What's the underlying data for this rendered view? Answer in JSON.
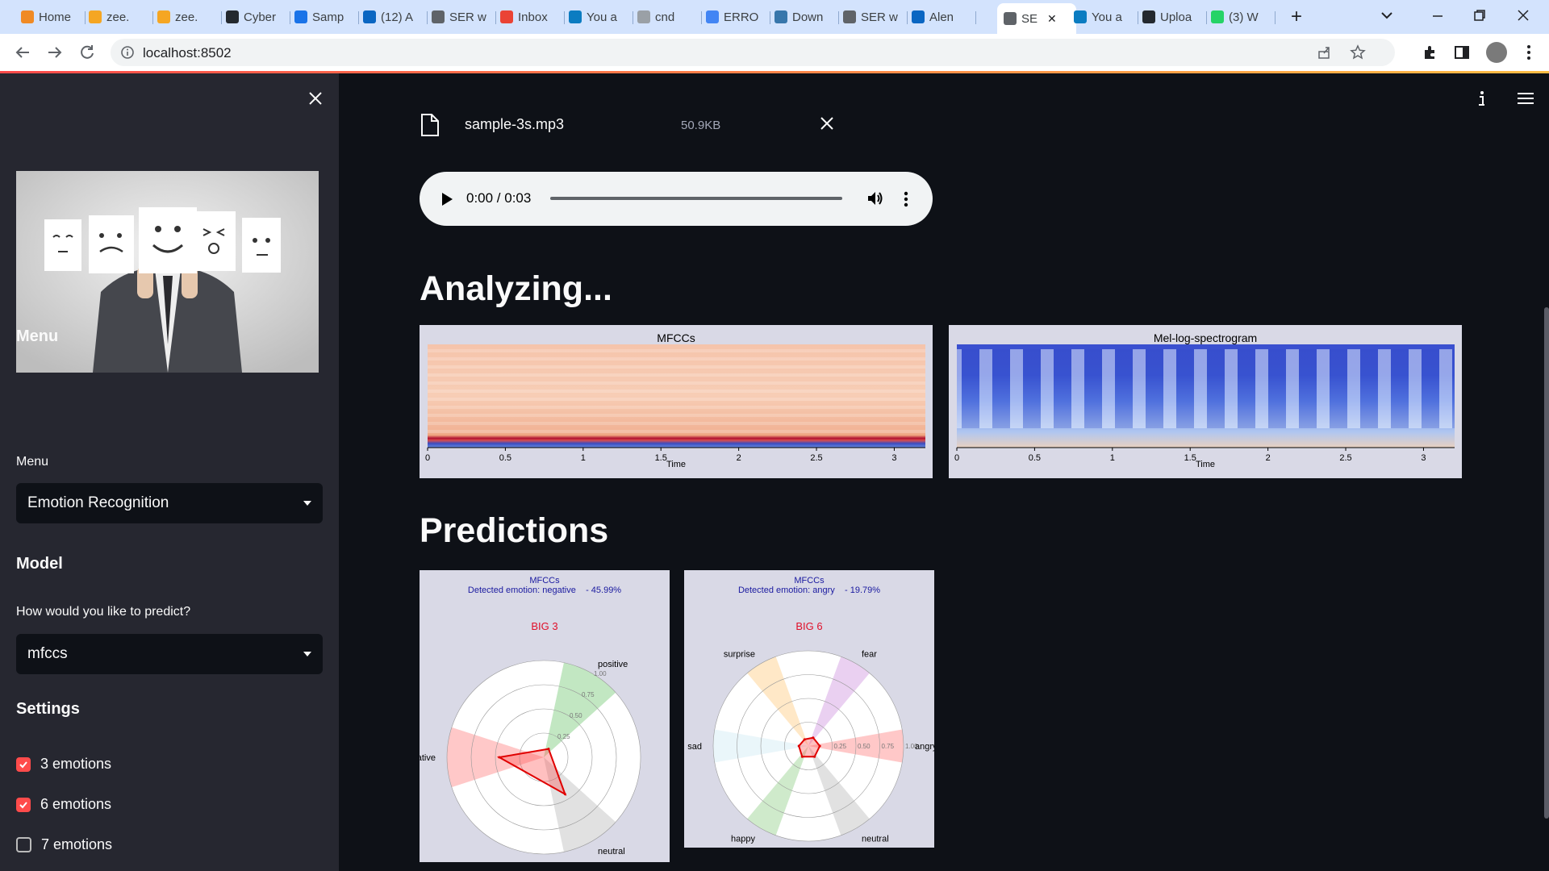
{
  "browser": {
    "tabs": [
      {
        "label": "Home",
        "color": "#f08a24"
      },
      {
        "label": "zee.",
        "color": "#f5a623"
      },
      {
        "label": "zee.",
        "color": "#f5a623"
      },
      {
        "label": "Cyber",
        "color": "#24292f"
      },
      {
        "label": "Samp",
        "color": "#1a73e8"
      },
      {
        "label": "(12) A",
        "color": "#0a66c2"
      },
      {
        "label": "SER w",
        "color": "#5f6368"
      },
      {
        "label": "Inbox",
        "color": "#ea4335"
      },
      {
        "label": "You a",
        "color": "#0b7cc1"
      },
      {
        "label": "cnd",
        "color": "#9aa0a6"
      },
      {
        "label": "ERRO",
        "color": "#4285f4"
      },
      {
        "label": "Down",
        "color": "#3776ab"
      },
      {
        "label": "SER w",
        "color": "#5f6368"
      },
      {
        "label": "Alen",
        "color": "#0a66c2"
      },
      {
        "label": "SE",
        "color": "#5f6368"
      },
      {
        "label": "You a",
        "color": "#0b7cc1"
      },
      {
        "label": "Uploa",
        "color": "#24292f"
      },
      {
        "label": "(3) W",
        "color": "#25d366"
      }
    ],
    "url": "localhost:8502"
  },
  "sidebar": {
    "menu_title": "Menu",
    "menu_label": "Menu",
    "menu_value": "Emotion Recognition",
    "model_title": "Model",
    "predict_label": "How would you like to predict?",
    "predict_value": "mfccs",
    "settings_title": "Settings",
    "checkboxes": [
      {
        "label": "3 emotions",
        "checked": true
      },
      {
        "label": "6 emotions",
        "checked": true
      },
      {
        "label": "7 emotions",
        "checked": false
      }
    ]
  },
  "file": {
    "name": "sample-3s.mp3",
    "size": "50.9KB"
  },
  "audio": {
    "time": "0:00 / 0:03",
    "progress": 0.0
  },
  "analyzing_title": "Analyzing...",
  "predictions_title": "Predictions",
  "spectrograms": [
    {
      "title": "MFCCs",
      "xlabel": "Time",
      "ticks": [
        "0",
        "0.5",
        "1",
        "1.5",
        "2",
        "2.5",
        "3"
      ]
    },
    {
      "title": "Mel-log-spectrogram",
      "xlabel": "Time",
      "ticks": [
        "0",
        "0.5",
        "1",
        "1.5",
        "2",
        "2.5",
        "3"
      ]
    }
  ],
  "chart_data": [
    {
      "type": "radar",
      "title": "MFCCs",
      "subtitle": "Detected emotion: negative",
      "score_text": "- 45.99%",
      "chart_label": "BIG 3",
      "categories": [
        "positive",
        "negative",
        "neutral"
      ],
      "values": [
        0.1,
        0.46,
        0.44
      ],
      "radial_ticks": [
        "0.25",
        "0.50",
        "0.75",
        "1.00"
      ],
      "ylim": [
        0,
        1
      ],
      "colors": [
        "#8fd48f",
        "#ff9b9b",
        "#c8c8c8"
      ]
    },
    {
      "type": "radar",
      "title": "MFCCs",
      "subtitle": "Detected emotion: angry",
      "score_text": "- 19.79%",
      "chart_label": "BIG 6",
      "categories": [
        "angry",
        "fear",
        "surprise",
        "sad",
        "happy",
        "neutral"
      ],
      "values": [
        0.12,
        0.1,
        0.08,
        0.1,
        0.13,
        0.13
      ],
      "radial_ticks": [
        "0.25",
        "0.50",
        "0.75",
        "1.00"
      ],
      "ylim": [
        0,
        1
      ],
      "colors": [
        "#ff9b9b",
        "#d9a9e6",
        "#ffd699",
        "#d8eef5",
        "#a8d8a0",
        "#c8c8c8"
      ]
    }
  ]
}
